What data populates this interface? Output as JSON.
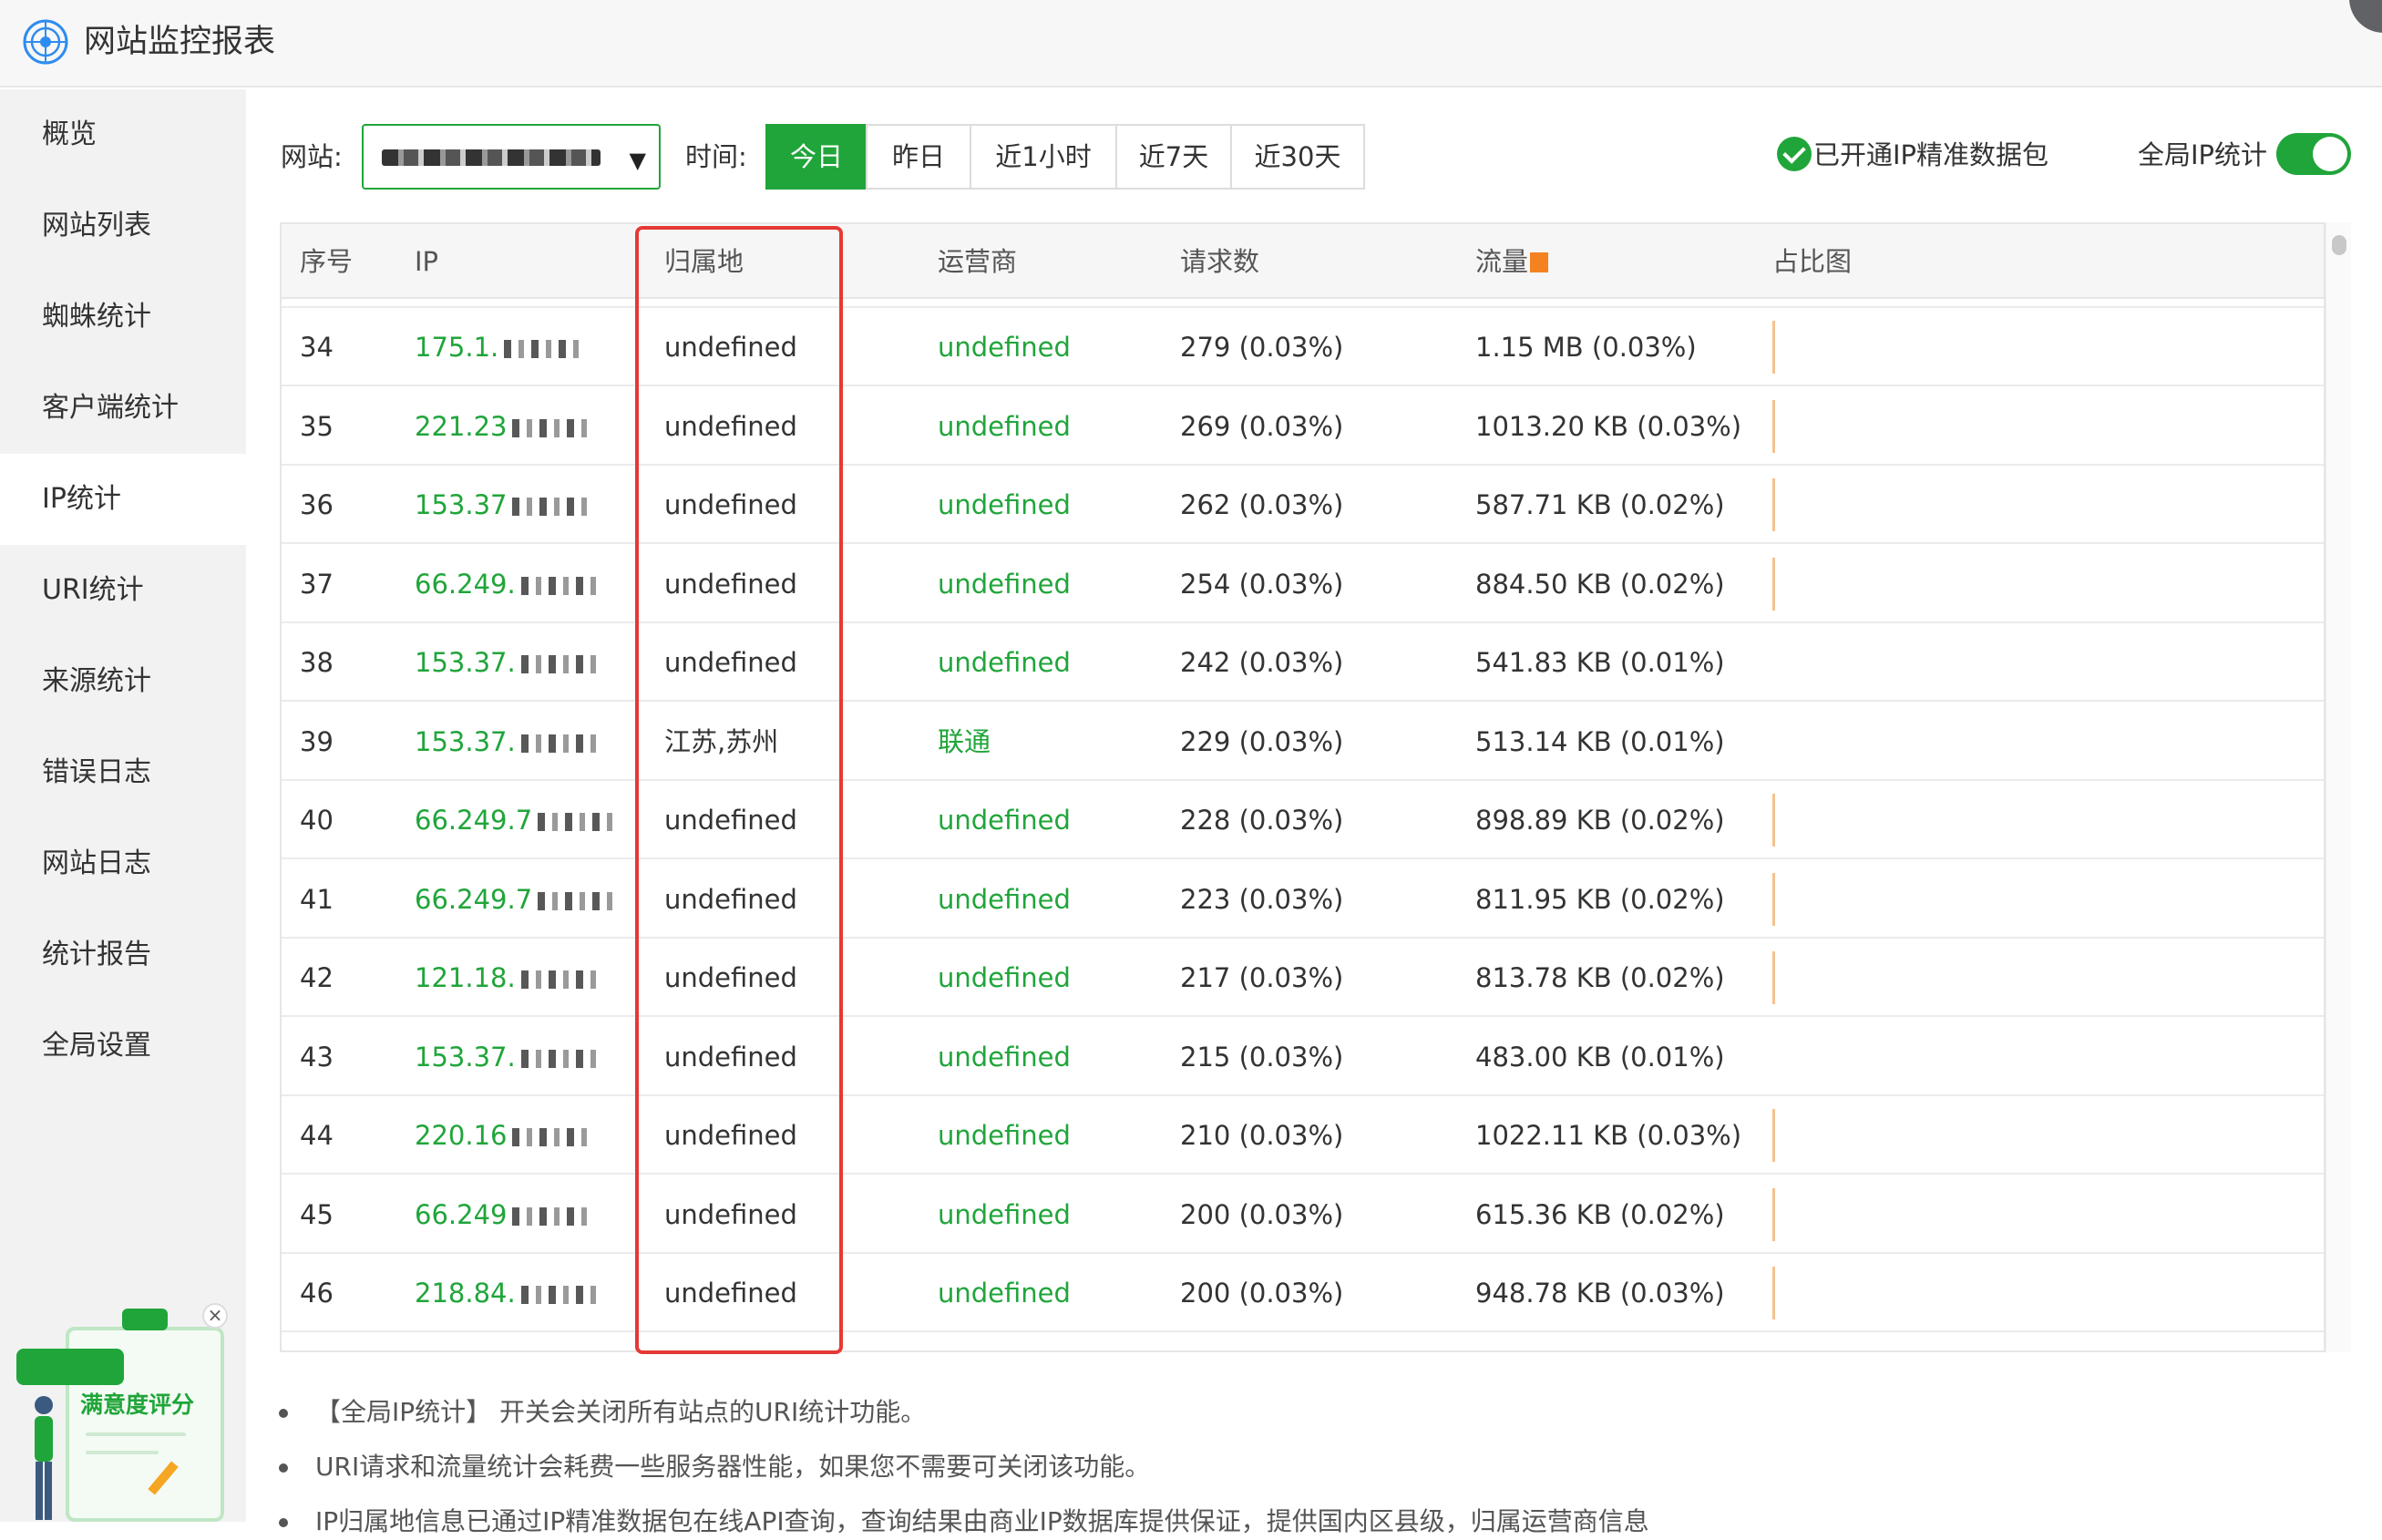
{
  "app": {
    "title": "网站监控报表"
  },
  "sidebar": {
    "items": [
      {
        "label": "概览"
      },
      {
        "label": "网站列表"
      },
      {
        "label": "蜘蛛统计"
      },
      {
        "label": "客户端统计"
      },
      {
        "label": "IP统计",
        "active": true
      },
      {
        "label": "URI统计"
      },
      {
        "label": "来源统计"
      },
      {
        "label": "错误日志"
      },
      {
        "label": "网站日志"
      },
      {
        "label": "统计报告"
      },
      {
        "label": "全局设置"
      }
    ]
  },
  "filter": {
    "site_label": "网站:",
    "time_label": "时间:",
    "time_ranges": [
      "今日",
      "昨日",
      "近1小时",
      "近7天",
      "近30天"
    ],
    "active_range": "今日",
    "ip_pack_status": "已开通IP精准数据包",
    "global_ip_label": "全局IP统计",
    "global_ip_enabled": true
  },
  "table": {
    "headers": [
      "序号",
      "IP",
      "归属地",
      "运营商",
      "请求数",
      "流量",
      "占比图"
    ],
    "rows": [
      {
        "no": "34",
        "ip": "175.1.",
        "location": "undefined",
        "isp": "undefined",
        "requests": "279 (0.03%)",
        "traffic": "1.15 MB (0.03%)",
        "bar": true
      },
      {
        "no": "35",
        "ip": "221.23",
        "location": "undefined",
        "isp": "undefined",
        "requests": "269 (0.03%)",
        "traffic": "1013.20 KB (0.03%)",
        "bar": true
      },
      {
        "no": "36",
        "ip": "153.37",
        "location": "undefined",
        "isp": "undefined",
        "requests": "262 (0.03%)",
        "traffic": "587.71 KB (0.02%)",
        "bar": true
      },
      {
        "no": "37",
        "ip": "66.249.",
        "location": "undefined",
        "isp": "undefined",
        "requests": "254 (0.03%)",
        "traffic": "884.50 KB (0.02%)",
        "bar": true
      },
      {
        "no": "38",
        "ip": "153.37.",
        "location": "undefined",
        "isp": "undefined",
        "requests": "242 (0.03%)",
        "traffic": "541.83 KB (0.01%)",
        "bar": false
      },
      {
        "no": "39",
        "ip": "153.37.",
        "location": "江苏,苏州",
        "isp": "联通",
        "requests": "229 (0.03%)",
        "traffic": "513.14 KB (0.01%)",
        "bar": false
      },
      {
        "no": "40",
        "ip": "66.249.7",
        "location": "undefined",
        "isp": "undefined",
        "requests": "228 (0.03%)",
        "traffic": "898.89 KB (0.02%)",
        "bar": true
      },
      {
        "no": "41",
        "ip": "66.249.7",
        "location": "undefined",
        "isp": "undefined",
        "requests": "223 (0.03%)",
        "traffic": "811.95 KB (0.02%)",
        "bar": true
      },
      {
        "no": "42",
        "ip": "121.18.",
        "location": "undefined",
        "isp": "undefined",
        "requests": "217 (0.03%)",
        "traffic": "813.78 KB (0.02%)",
        "bar": true
      },
      {
        "no": "43",
        "ip": "153.37.",
        "location": "undefined",
        "isp": "undefined",
        "requests": "215 (0.03%)",
        "traffic": "483.00 KB (0.01%)",
        "bar": false
      },
      {
        "no": "44",
        "ip": "220.16",
        "location": "undefined",
        "isp": "undefined",
        "requests": "210 (0.03%)",
        "traffic": "1022.11 KB (0.03%)",
        "bar": true
      },
      {
        "no": "45",
        "ip": "66.249",
        "location": "undefined",
        "isp": "undefined",
        "requests": "200 (0.03%)",
        "traffic": "615.36 KB (0.02%)",
        "bar": true
      },
      {
        "no": "46",
        "ip": "218.84.",
        "location": "undefined",
        "isp": "undefined",
        "requests": "200 (0.03%)",
        "traffic": "948.78 KB (0.03%)",
        "bar": true
      }
    ]
  },
  "notes": [
    "【全局IP统计】 开关会关闭所有站点的URI统计功能。",
    "URI请求和流量统计会耗费一些服务器性能，如果您不需要可关闭该功能。",
    "IP归属地信息已通过IP精准数据包在线API查询，查询结果由商业IP数据库提供保证，提供国内区县级，归属运营商信息"
  ],
  "feedback": {
    "label": "满意度评分",
    "close": "×"
  },
  "colors": {
    "accent": "#20a53a",
    "highlight": "#e53935",
    "flow_square": "#f58220"
  }
}
